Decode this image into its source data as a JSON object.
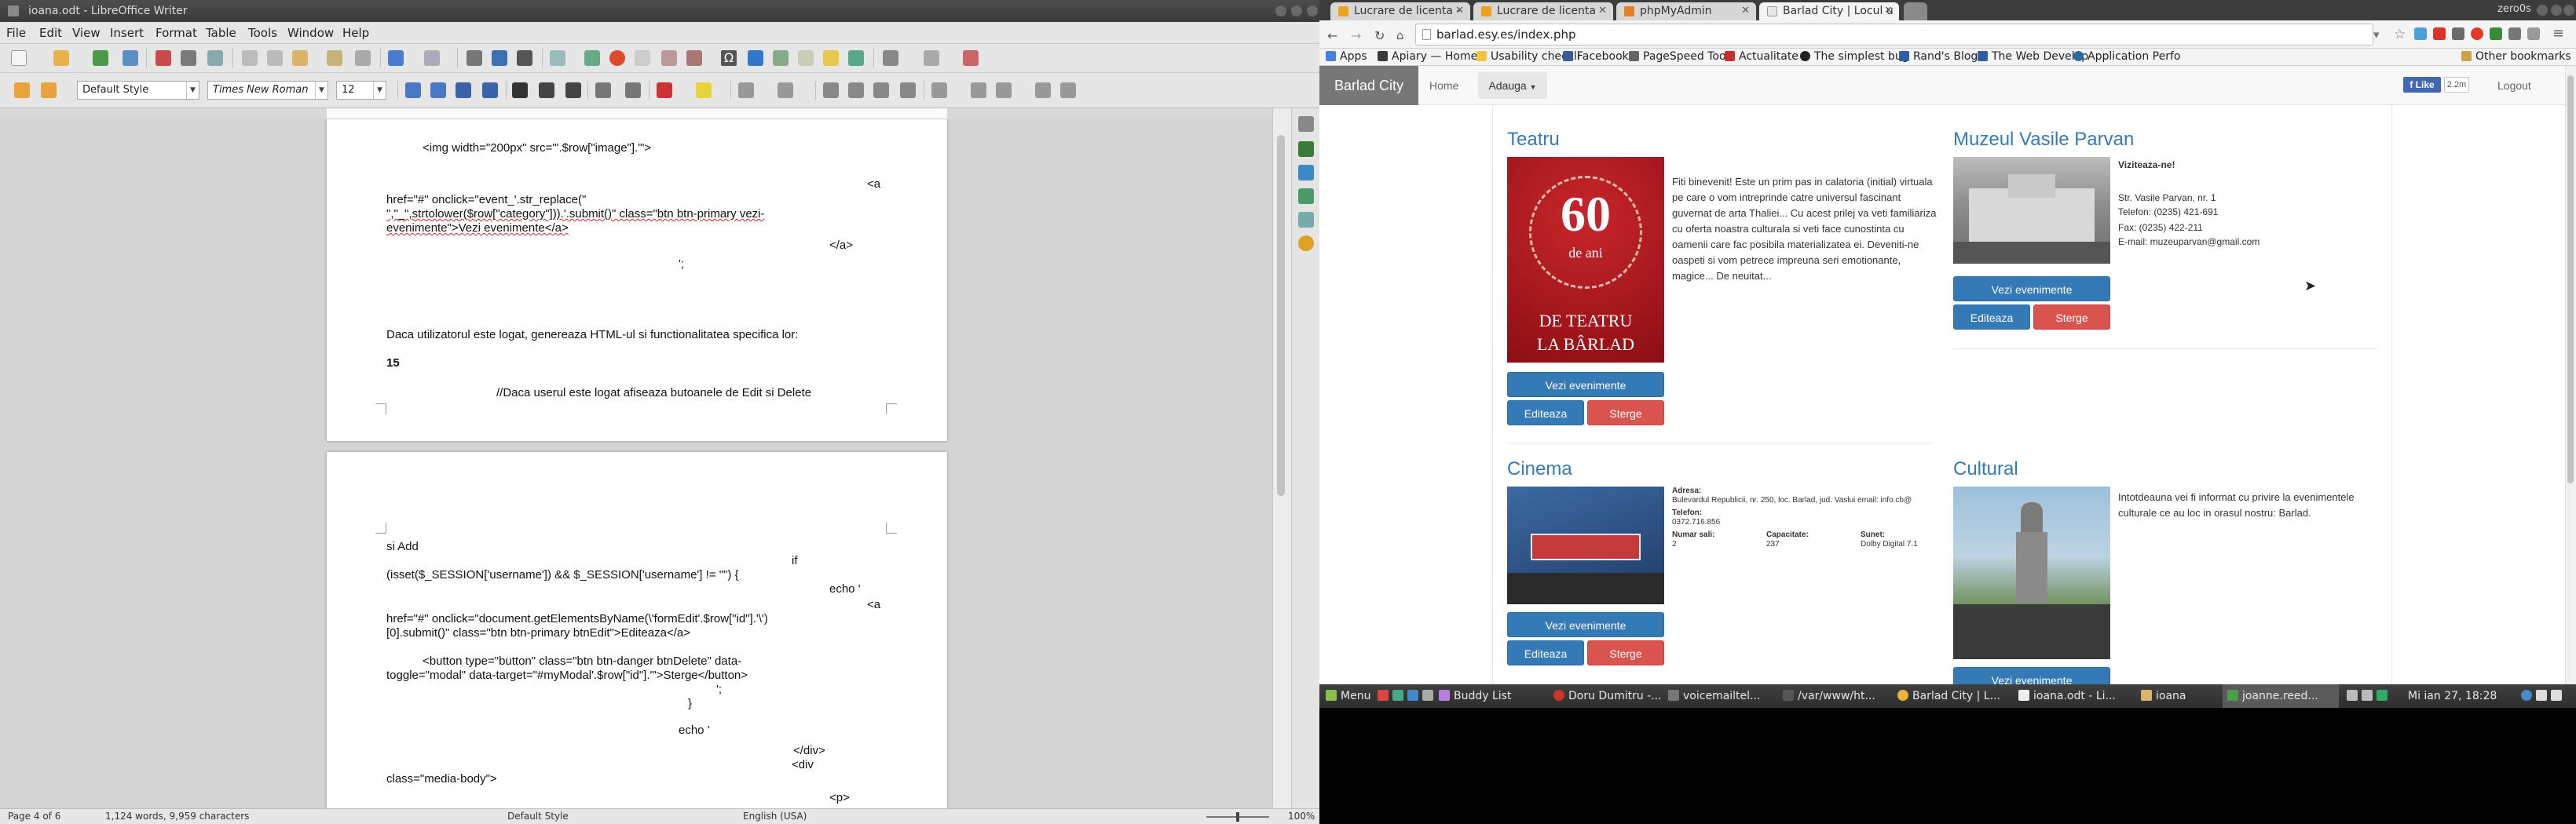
{
  "writer": {
    "title": "ioana.odt - LibreOffice Writer",
    "menu": [
      "File",
      "Edit",
      "View",
      "Insert",
      "Format",
      "Table",
      "Tools",
      "Window",
      "Help"
    ],
    "para_style": "Default Style",
    "font_name": "Times New Roman",
    "font_size": "12",
    "page1_lines": [
      "<img width=\"200px\" src=\"'.$row[\"image\"].'\">",
      "<a",
      "href=\"#\" onclick=\"event_'.str_replace(\"",
      "\",\"_\",strtolower($row[\"category\"])).'.submit()\" class=\"btn btn-primary vezi-",
      "evenimente\">Vezi evenimente</a>",
      "</a>",
      "';",
      "Daca utilizatorul este logat, genereaza  HTML-ul si functionalitatea specifica lor:",
      "15",
      "//Daca userul este logat afiseaza butoanele de Edit si Delete"
    ],
    "page2_lines": [
      "si Add",
      "if",
      "(isset($_SESSION['username']) && $_SESSION['username'] != \"\") {",
      "echo '",
      "<a",
      "href=\"#\" onclick=\"document.getElementsByName(\\'formEdit'.$row[\"id\"].'\\')",
      "[0].submit()\" class=\"btn btn-primary btnEdit\">Editeaza</a>",
      "<button type=\"button\" class=\"btn btn-danger btnDelete\" data-",
      "toggle=\"modal\" data-target=\"#myModal'.$row[\"id\"].'\">Sterge</button>",
      "';",
      "}",
      "echo '",
      "</div>",
      "<div",
      "class=\"media-body\">",
      "<p>"
    ],
    "status": {
      "page": "Page 4 of 6",
      "words": "1,124 words, 9,959 characters",
      "style": "Default Style",
      "lang": "English (USA)",
      "zoom": "100%"
    }
  },
  "browser": {
    "user": "zero0s",
    "tabs": [
      {
        "title": "Lucrare de licenta - ",
        "active": false,
        "fav": "#f0a020"
      },
      {
        "title": "Lucrare de licenta",
        "active": false,
        "fav": "#f0a020"
      },
      {
        "title": "phpMyAdmin",
        "active": false,
        "fav": "#e67e22"
      },
      {
        "title": "Barlad City | Locul u",
        "active": true,
        "fav": "#e6e6e6"
      }
    ],
    "url": "barlad.esy.es/index.php",
    "bookmarks": [
      "Apps",
      "Apiary — Home",
      "Usability checkli",
      "Facebook",
      "PageSpeed Tools",
      "Actualitate",
      "The simplest bug",
      "Rand's Blog",
      "The Web Develop",
      "Application Perfo"
    ],
    "other_bookmarks": "Other bookmarks",
    "site": {
      "brand": "Barlad City",
      "home": "Home",
      "add": "Adauga",
      "fb_like": "Like",
      "fb_count": "2.2m",
      "logout": "Logout",
      "cards": [
        {
          "title": "Teatru",
          "poster": {
            "line1": "60",
            "line2": "de ani",
            "line3": "DE TEATRU",
            "line4": "LA BÂRLAD"
          },
          "text": "Fiti binevenit! Este un prim pas in calatoria (initial) virtuala pe care o vom intreprinde catre universul fascinant guvernat de arta Thaliei... Cu acest prilej va veti familiariza cu oferta noastra culturala si veti face cunostinta cu oamenii care fac posibila materializatea ei. Deveniti-ne oaspeti si vom petrece impreuna seri emotionante, magice... De neuitat...",
          "btn_events": "Vezi evenimente",
          "btn_edit": "Editeaza",
          "btn_delete": "Sterge"
        },
        {
          "title": "Muzeul Vasile Parvan",
          "lines": [
            "Viziteaza-ne!",
            "",
            "Str. Vasile Parvan, nr. 1",
            "Telefon: (0235) 421-691",
            "Fax: (0235) 422-211",
            "E-mail: muzeuparvan@gmail.com"
          ],
          "btn_events": "Vezi evenimente",
          "btn_edit": "Editeaza",
          "btn_delete": "Sterge"
        },
        {
          "title": "Cinema",
          "adresa_label": "Adresa:",
          "adresa": "Bulevardul Republicii, nr. 250, loc. Barlad, jud. Vaslui email: info.cb@",
          "telefon_label": "Telefon:",
          "telefon": "0372.716.856",
          "sali_label": "Numar sali:",
          "sali": "2",
          "cap_label": "Capacitate:",
          "cap": "237",
          "sunet_label": "Sunet:",
          "sunet": "Dolby Digital 7.1",
          "btn_events": "Vezi evenimente",
          "btn_edit": "Editeaza",
          "btn_delete": "Sterge"
        },
        {
          "title": "Cultural",
          "text": "Intotdeauna vei fi informat cu privire la evenimentele culturale ce au loc in orasul nostru: Barlad.",
          "btn_events": "Vezi evenimente"
        }
      ]
    }
  },
  "taskbar": {
    "menu": "Menu",
    "items": [
      "Buddy List",
      "Doru Dumitru -...",
      "voicemailtel...",
      "/var/www/ht...",
      "Barlad City | L...",
      "ioana.odt - Li...",
      "ioana",
      "joanne.reed..."
    ],
    "clock": "Mi ian 27, 18:28"
  }
}
